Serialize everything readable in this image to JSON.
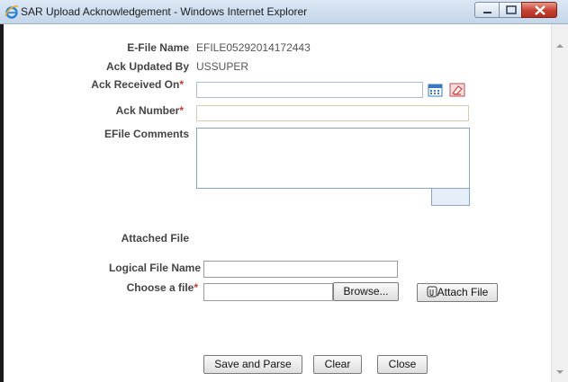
{
  "window": {
    "title": "SAR Upload Acknowledgement - Windows Internet Explorer"
  },
  "form": {
    "efile_name_label": "E-File Name",
    "efile_name_value": "EFILE05292014172443",
    "ack_updated_by_label": "Ack Updated By",
    "ack_updated_by_value": "USSUPER",
    "ack_received_on_label": "Ack Received On",
    "ack_received_on_value": "",
    "ack_number_label": "Ack Number",
    "ack_number_value": "",
    "efile_comments_label": "EFile Comments",
    "efile_comments_value": "",
    "required_marker": "*",
    "attached_file_label": "Attached File",
    "logical_file_name_label": "Logical File Name",
    "logical_file_name_value": "",
    "choose_file_label": "Choose a file",
    "choose_file_value": ""
  },
  "buttons": {
    "browse": "Browse...",
    "attach_file": "Attach File",
    "save_and_parse": "Save and Parse",
    "clear": "Clear",
    "close": "Close"
  },
  "icons": {
    "browser": "internet-explorer-icon",
    "calendar": "calendar-icon",
    "clear_date": "eraser-icon",
    "attach": "paperclip-icon"
  },
  "colors": {
    "required": "#c0392b",
    "titlebar": "#c4d6ea",
    "close_button": "#c44030"
  }
}
